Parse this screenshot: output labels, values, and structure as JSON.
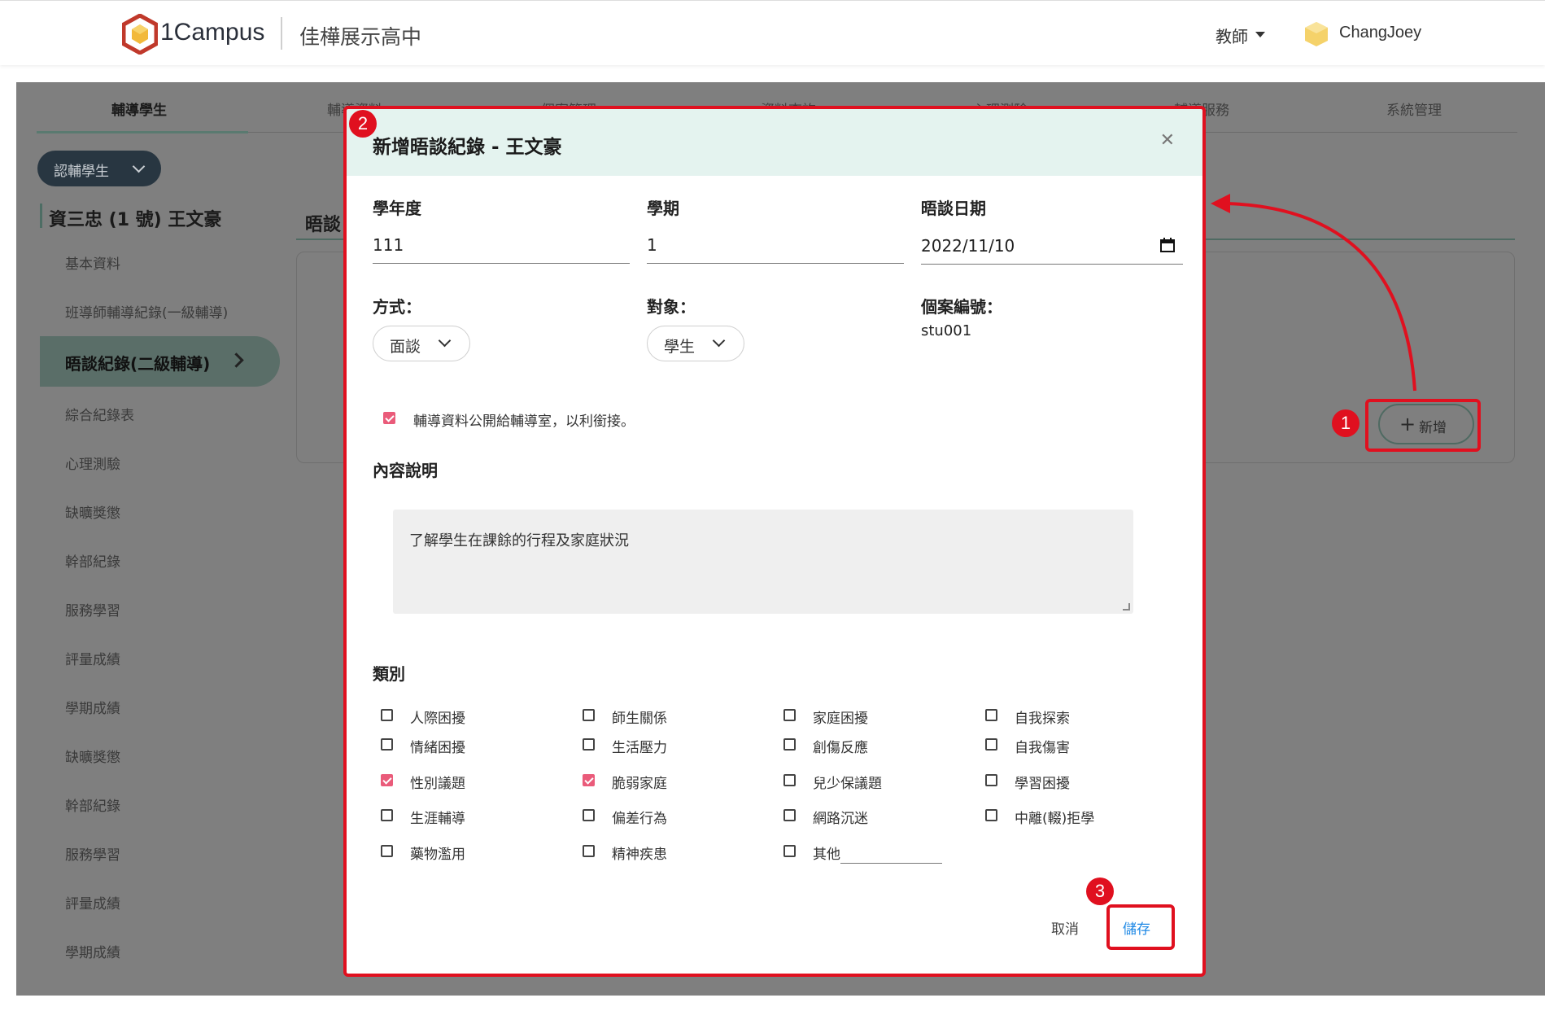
{
  "header": {
    "logo_text": "1Campus",
    "school_name": "佳樺展示高中",
    "role": "教師",
    "username": "ChangJoey"
  },
  "nav": {
    "tabs": [
      {
        "label": "輔導學生",
        "active": true
      },
      {
        "label": "輔導資料"
      },
      {
        "label": "個案管理"
      },
      {
        "label": "資料查詢"
      },
      {
        "label": "心理測驗"
      },
      {
        "label": "輔導服務"
      },
      {
        "label": "系統管理"
      }
    ]
  },
  "sidebar": {
    "group_button": "認輔學生",
    "student": "資三忠 (1 號) 王文豪",
    "items": [
      {
        "label": "基本資料"
      },
      {
        "label": "班導師輔導紀錄(一級輔導)"
      },
      {
        "label": "晤談紀錄(二級輔導)",
        "active": true
      },
      {
        "label": "綜合紀錄表"
      },
      {
        "label": "心理測驗"
      },
      {
        "label": "缺曠獎懲"
      },
      {
        "label": "幹部紀錄"
      },
      {
        "label": "服務學習"
      },
      {
        "label": "評量成績"
      },
      {
        "label": "學期成績"
      },
      {
        "label": "缺曠獎懲"
      },
      {
        "label": "幹部紀錄"
      },
      {
        "label": "服務學習"
      },
      {
        "label": "評量成績"
      },
      {
        "label": "學期成績"
      }
    ]
  },
  "main": {
    "section_title": "晤談",
    "add_button": "新增"
  },
  "modal": {
    "title": "新增晤談紀錄 - 王文豪",
    "school_year_label": "學年度",
    "school_year": "111",
    "semester_label": "學期",
    "semester": "1",
    "date_label": "晤談日期",
    "date": "2022/11/10",
    "method_label": "方式：",
    "method": "面談",
    "target_label": "對象：",
    "target": "學生",
    "case_no_label": "個案編號：",
    "case_no": "stu001",
    "share_checkbox": {
      "label": "輔導資料公開給輔導室，以利銜接。",
      "checked": true
    },
    "content_label": "內容說明",
    "content": "了解學生在課餘的行程及家庭狀況",
    "category_label": "類別",
    "categories": [
      {
        "label": "人際困擾",
        "checked": false
      },
      {
        "label": "師生關係",
        "checked": false
      },
      {
        "label": "家庭困擾",
        "checked": false
      },
      {
        "label": "自我探索",
        "checked": false
      },
      {
        "label": "情緒困擾",
        "checked": false
      },
      {
        "label": "生活壓力",
        "checked": false
      },
      {
        "label": "創傷反應",
        "checked": false
      },
      {
        "label": "自我傷害",
        "checked": false
      },
      {
        "label": "性別議題",
        "checked": true
      },
      {
        "label": "脆弱家庭",
        "checked": true
      },
      {
        "label": "兒少保議題",
        "checked": false
      },
      {
        "label": "學習困擾",
        "checked": false
      },
      {
        "label": "生涯輔導",
        "checked": false
      },
      {
        "label": "偏差行為",
        "checked": false
      },
      {
        "label": "網路沉迷",
        "checked": false
      },
      {
        "label": "中離(輟)拒學",
        "checked": false
      },
      {
        "label": "藥物濫用",
        "checked": false
      },
      {
        "label": "精神疾患",
        "checked": false
      },
      {
        "label": "其他",
        "checked": false
      }
    ],
    "cancel_button": "取消",
    "save_button": "儲存"
  },
  "annotations": {
    "step1": "1",
    "step2": "2",
    "step3": "3"
  },
  "colors": {
    "highlight_red": "#e0101f",
    "checkbox_pink": "#ea5b7a",
    "save_blue": "#1e88e5",
    "header_mint": "#e4f3ef"
  }
}
